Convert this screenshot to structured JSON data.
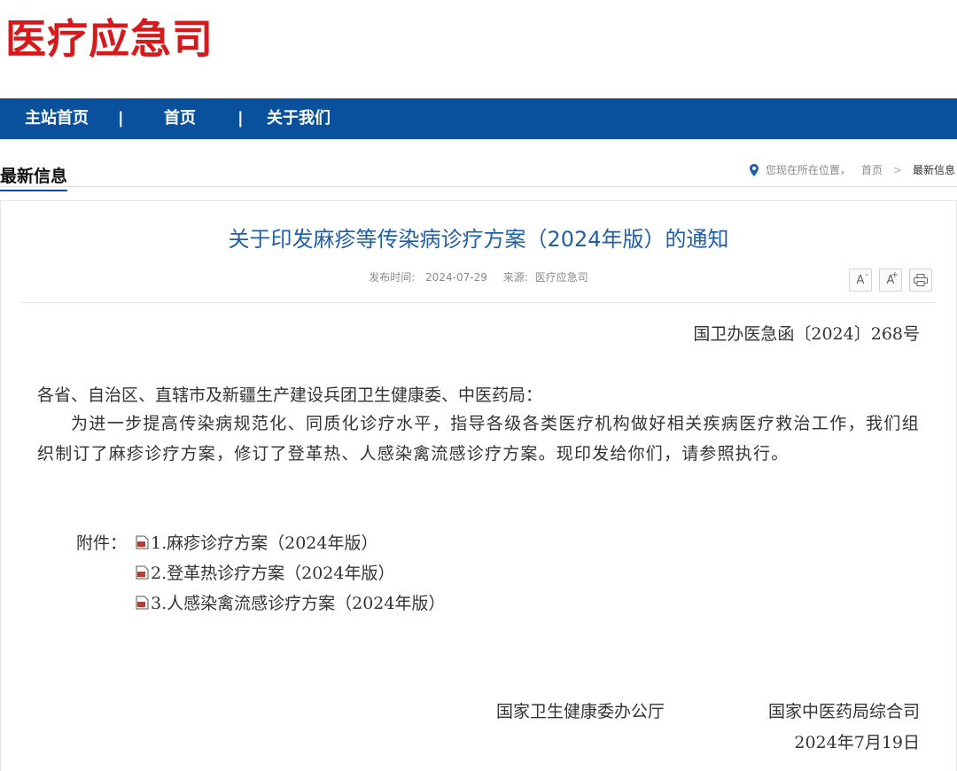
{
  "site": {
    "logo_text": "医疗应急司",
    "brand_color": "#d7191c",
    "nav_color": "#0a519d"
  },
  "nav": {
    "items": [
      {
        "label": "主站首页"
      },
      {
        "label": "首页"
      },
      {
        "label": "关于我们"
      }
    ],
    "separator": "|"
  },
  "section": {
    "title": "最新信息"
  },
  "breadcrumb": {
    "prefix": "您现在所在位置，",
    "home": "首页",
    "separator": ">",
    "current": "最新信息",
    "icon": "location-pin-icon"
  },
  "article": {
    "title": "关于印发麻疹等传染病诊疗方案（2024年版）的通知",
    "publish_label": "发布时间:",
    "publish_date": "2024-07-29",
    "source_label": "来源:",
    "source": "医疗应急司",
    "tools": [
      {
        "label": "A",
        "icon": "font-decrease-icon"
      },
      {
        "label": "A",
        "icon": "font-increase-icon"
      },
      {
        "icon": "print-icon"
      }
    ],
    "doc_number": "国卫办医急函〔2024〕268号",
    "salutation": "各省、自治区、直辖市及新疆生产建设兵团卫生健康委、中医药局：",
    "body": "为进一步提高传染病规范化、同质化诊疗水平，指导各级各类医疗机构做好相关疾病医疗救治工作，我们组织制订了麻疹诊疗方案，修订了登革热、人感染禽流感诊疗方案。现印发给你们，请参照执行。",
    "attachments_label": "附件：",
    "attachments": [
      {
        "label": "1.麻疹诊疗方案（2024年版）",
        "icon": "pdf-file-icon"
      },
      {
        "label": "2.登革热诊疗方案（2024年版）",
        "icon": "pdf-file-icon"
      },
      {
        "label": "3.人感染禽流感诊疗方案（2024年版）",
        "icon": "pdf-file-icon"
      }
    ],
    "signers": [
      "国家卫生健康委办公厅",
      "国家中医药局综合司"
    ],
    "sign_date": "2024年7月19日"
  }
}
